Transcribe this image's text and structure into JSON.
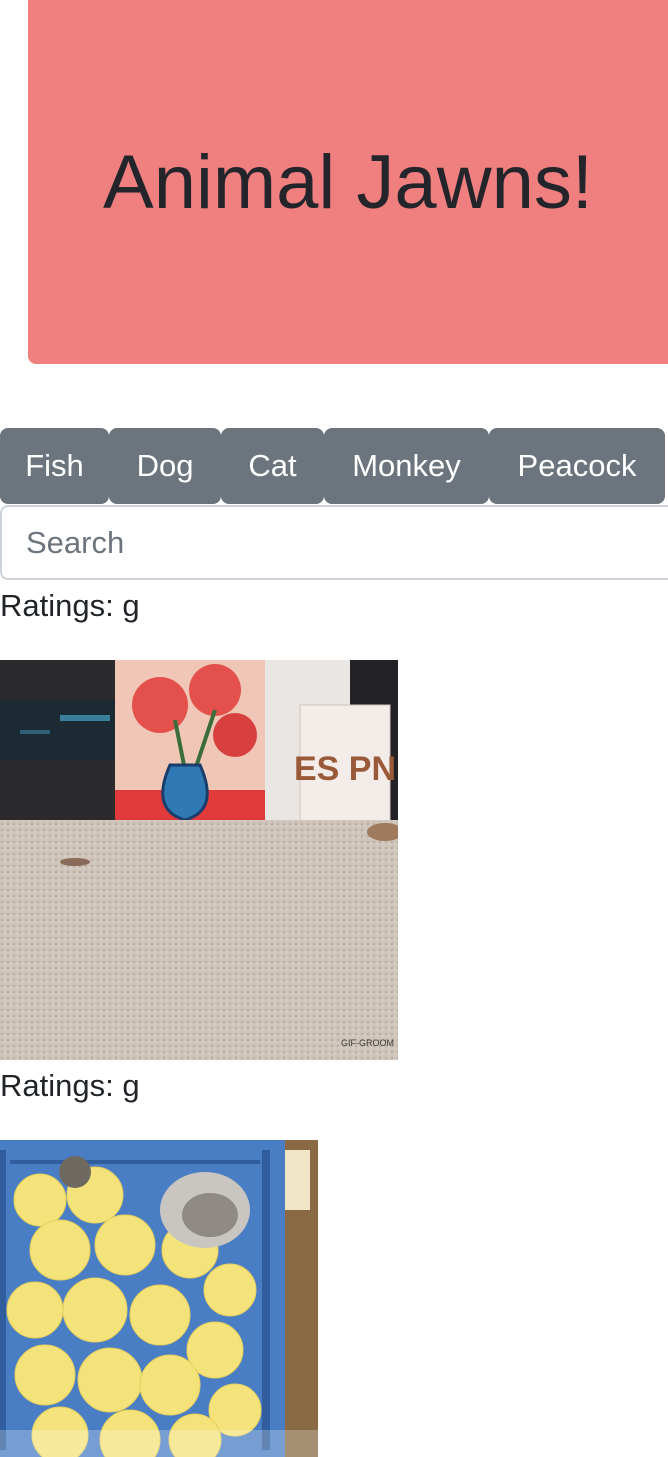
{
  "header": {
    "title": "Animal Jawns!"
  },
  "animal_buttons": [
    {
      "label": "Fish"
    },
    {
      "label": "Dog"
    },
    {
      "label": "Cat"
    },
    {
      "label": "Monkey"
    },
    {
      "label": "Peacock"
    }
  ],
  "search": {
    "placeholder": "Search",
    "value": ""
  },
  "results": [
    {
      "rating": "Ratings: g",
      "image_subject": "cat on carpet with vase painting and ESPN book",
      "book_text": "ES PN",
      "watermark": "GIF-GROOM"
    },
    {
      "rating": "Ratings: g",
      "image_subject": "cat among yellow chicks in a blue crate"
    }
  ],
  "colors": {
    "jumbotron": "#f08080",
    "button": "#6c757d",
    "text": "#212529"
  }
}
